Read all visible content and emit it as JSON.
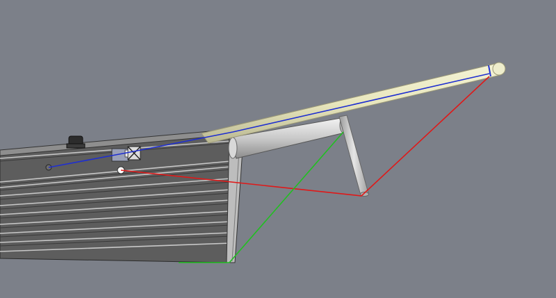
{
  "viewport": {
    "background_color": "#7c8089",
    "rigging_colors": {
      "forestay": "#1f2fd0",
      "bobstay": "#e01818",
      "bowsprit_guy": "#20c020"
    }
  },
  "model": {
    "parts": [
      {
        "id": "hull",
        "icon": "ship-hull-icon"
      },
      {
        "id": "bowsprit",
        "icon": "spar-icon"
      },
      {
        "id": "dolphin-striker",
        "icon": "strut-icon"
      }
    ]
  }
}
